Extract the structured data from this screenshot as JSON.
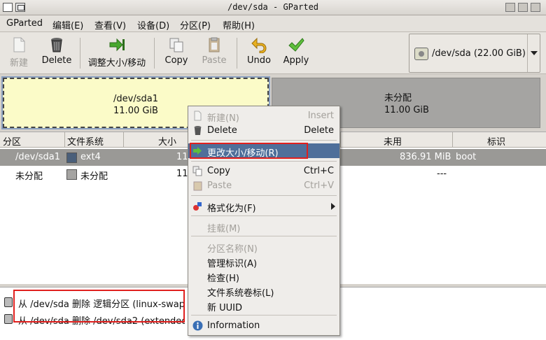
{
  "window": {
    "title": "/dev/sda - GParted"
  },
  "menubar": {
    "items": [
      "GParted",
      "编辑(E)",
      "查看(V)",
      "设备(D)",
      "分区(P)",
      "帮助(H)"
    ]
  },
  "toolbar": {
    "new_label": "新建",
    "delete_label": "Delete",
    "resize_label": "调整大小/移动",
    "copy_label": "Copy",
    "paste_label": "Paste",
    "undo_label": "Undo",
    "apply_label": "Apply",
    "device_selector": "/dev/sda  (22.00 GiB)"
  },
  "diskmap": {
    "part1_name": "/dev/sda1",
    "part1_size": "11.00 GiB",
    "unalloc_name": "未分配",
    "unalloc_size": "11.00 GiB"
  },
  "table": {
    "headers": [
      "分区",
      "文件系统",
      "大小",
      "未用",
      "标识"
    ],
    "rows": [
      {
        "partition": "/dev/sda1",
        "filesystem": "ext4",
        "fs_color": "#4a5f7a",
        "size": "11",
        "unused": "836.91 MiB",
        "flags": "boot"
      },
      {
        "partition": "未分配",
        "filesystem": "未分配",
        "fs_color": "#a5a4a2",
        "size": "11",
        "unused": "---",
        "flags": ""
      }
    ]
  },
  "log": {
    "entries": [
      "从 /dev/sda 删除 逻辑分区 (linux-swap)",
      "从 /dev/sda 删除 /dev/sda2 (extended)"
    ]
  },
  "context_menu": {
    "new": {
      "label": "新建(N)",
      "shortcut": "Insert"
    },
    "delete": {
      "label": "Delete",
      "shortcut": "Delete"
    },
    "resize": {
      "label": "更改大小/移动(R)"
    },
    "copy": {
      "label": "Copy",
      "shortcut": "Ctrl+C"
    },
    "paste": {
      "label": "Paste",
      "shortcut": "Ctrl+V"
    },
    "format": {
      "label": "格式化为(F)"
    },
    "mount": {
      "label": "挂载(M)"
    },
    "name": {
      "label": "分区名称(N)"
    },
    "flags": {
      "label": "管理标识(A)"
    },
    "check": {
      "label": "检查(H)"
    },
    "fslabel": {
      "label": "文件系统卷标(L)"
    },
    "uuid": {
      "label": "新 UUID"
    },
    "info": {
      "label": "Information"
    }
  },
  "colors": {
    "highlight": "#4f6f9a",
    "annotation_red": "#e0201e",
    "partition_fill": "#fbfbc8",
    "unallocated_fill": "#a5a4a2"
  }
}
